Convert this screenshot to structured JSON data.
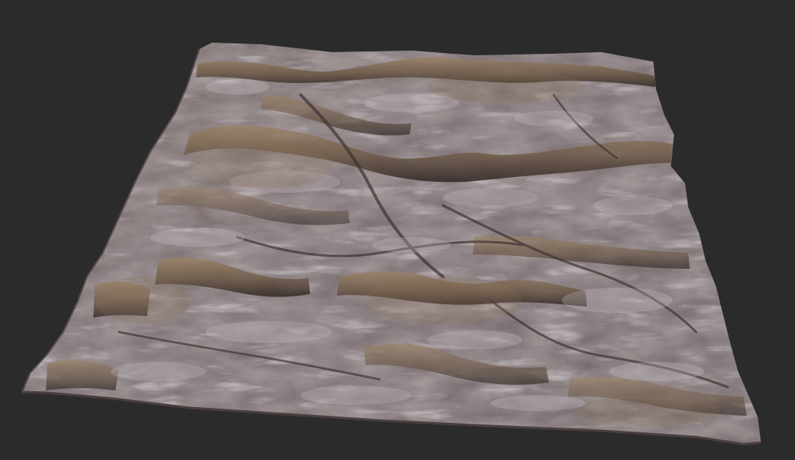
{
  "viewport": {
    "background_color": "#2b2b2b",
    "content": "3d-terrain-mesh",
    "terrain_colors": {
      "base": "#786a68",
      "light_rock": "#a79fa5",
      "highlight": "#cfcad0",
      "warm_sand": "#8b7257",
      "shadow": "#3f3636",
      "deep_shadow": "#2a2322"
    }
  }
}
